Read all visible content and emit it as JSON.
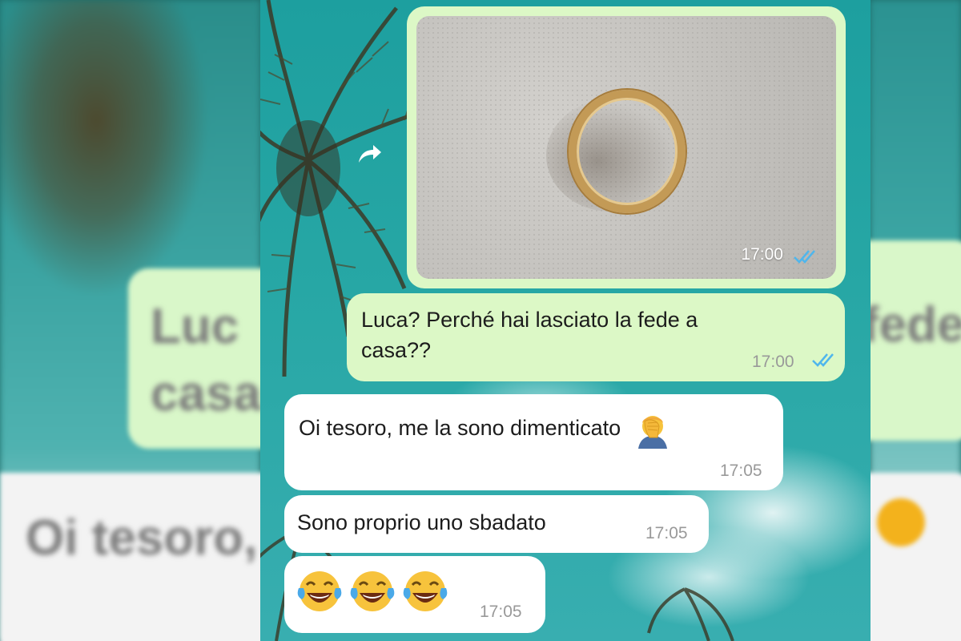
{
  "messages": [
    {
      "type": "image",
      "direction": "out",
      "time": "17:00",
      "status": "read"
    },
    {
      "type": "text",
      "direction": "out",
      "text_line1": "Luca? Perché hai lasciato la fede a",
      "text_line2": "casa??",
      "time": "17:00",
      "status": "read"
    },
    {
      "type": "text",
      "direction": "in",
      "text": "Oi tesoro, me la sono dimenticato",
      "emoji": "facepalm-emoji",
      "time": "17:05"
    },
    {
      "type": "text",
      "direction": "in",
      "text": "Sono proprio uno sbadato",
      "time": "17:05"
    },
    {
      "type": "emoji",
      "direction": "in",
      "emojis": [
        "laughing-tears-emoji",
        "laughing-tears-emoji",
        "laughing-tears-emoji"
      ],
      "time": "17:05"
    }
  ],
  "ghost": {
    "left_top": "Luc",
    "left_bottom": "casa",
    "left_white": "Oi tesoro,",
    "right_top": "fede a"
  },
  "icons": {
    "forward": "forward-arrow-icon",
    "read_receipt": "double-check-icon"
  },
  "colors": {
    "outgoing_bubble": "#dcf8c6",
    "incoming_bubble": "#ffffff",
    "read_ticks": "#4fb6ec"
  }
}
